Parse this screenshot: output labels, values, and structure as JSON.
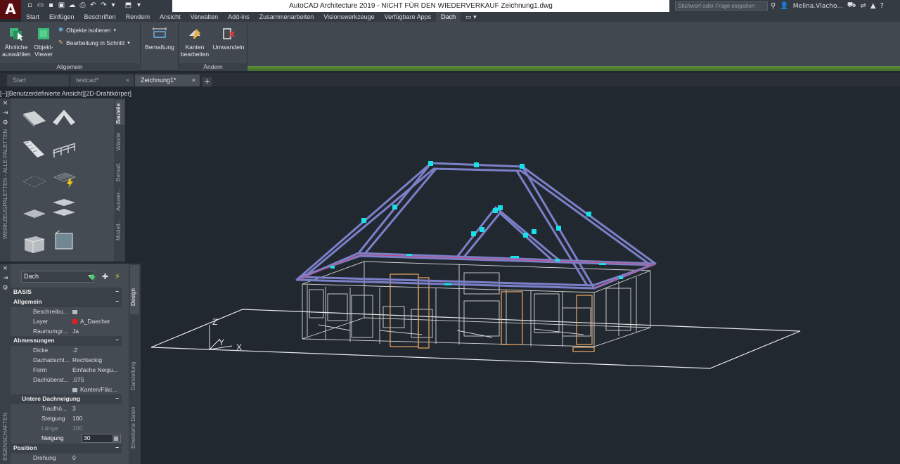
{
  "app": {
    "logo_letter": "A"
  },
  "quick_access": [
    "new-icon",
    "open-icon",
    "save-icon",
    "save-as-icon",
    "cloud-icon",
    "print-icon",
    "undo-icon",
    "redo-icon",
    "share-icon"
  ],
  "title": {
    "text": "AutoCAD Architecture 2019 - NICHT FÜR DEN WIEDERVERKAUF    Zeichnung1.dwg",
    "search_placeholder": "Stichwort oder Frage eingeben",
    "user": "Melina.Vlacho...",
    "help": "?"
  },
  "ribbon_tabs": [
    "Start",
    "Einfügen",
    "Beschriften",
    "Rendern",
    "Ansicht",
    "Verwalten",
    "Add-ins",
    "Zusammenarbeiten",
    "Visionswerkzeuge",
    "Verfügbare Apps",
    "Dach"
  ],
  "ribbon": {
    "active_tab": "Dach",
    "panel_allgemein": {
      "title": "Allgemein",
      "similar_line1": "Ähnliche",
      "similar_line2": "auswählen",
      "viewer_line1": "Objekt-",
      "viewer_line2": "Viewer",
      "isolate": "Objekte isolieren",
      "edit_section": "Bearbeitung in Schnitt"
    },
    "panel_bemassung": {
      "label": "Bemaßung"
    },
    "panel_aendern": {
      "title": "Ändern",
      "edges_line1": "Kanten",
      "edges_line2": "bearbeiten",
      "convert": "Umwandeln"
    }
  },
  "doc_tabs": [
    {
      "label": "Start"
    },
    {
      "label": "testcad*"
    },
    {
      "label": "Zeichnung1*"
    }
  ],
  "viewport": {
    "label": "[−][Benutzerdefinierte Ansicht][2D-Drahtkörper]",
    "ucs_z": "Z",
    "ucs_y": "Y",
    "ucs_x": "X"
  },
  "tool_palette": {
    "title": "WERKZEUGPALETTEN - ALLE PALETTEN",
    "tabs": [
      "Bauteile",
      "Wände",
      "Bemaß",
      "Auswer...",
      "Modell..."
    ],
    "active_tab": "Bauteile"
  },
  "properties": {
    "title": "EIGENSCHAFTEN",
    "object_type": "Dach",
    "tabs": [
      "Design",
      "Darstellung",
      "Erweiterte Daten"
    ],
    "basis": "BASIS",
    "general": {
      "header": "Allgemein",
      "description_label": "Beschreibu...",
      "layer_label": "Layer",
      "layer_value": "A_Daecher",
      "space_label": "Raumumgr...",
      "space_value": "Ja"
    },
    "dimensions": {
      "header": "Abmessungen",
      "thickness_label": "Dicke",
      "thickness_value": ".2",
      "edge_cut_label": "Dachabschl...",
      "edge_cut_value": "Rechteckig",
      "shape_label": "Form",
      "shape_value": "Einfache Neigu...",
      "overhang_label": "Dachüberst...",
      "overhang_value": ".075",
      "edges_value": "Kanten/Fläc..."
    },
    "lower_slope": {
      "header": "Untere Dachneigung",
      "eave_label": "Traufhö...",
      "eave_value": "3",
      "rise_label": "Steigung",
      "rise_value": "100",
      "run_label": "Länge",
      "run_value": "100",
      "slope_label": "Neigung",
      "slope_value": "30"
    },
    "position": {
      "header": "Position",
      "rotation_label": "Drehung",
      "rotation_value": "0"
    }
  },
  "colors": {
    "viewport_bg": "#212830",
    "roof_edges": "#7b80c8",
    "grips": "#18e0e8",
    "walls": "#d8d8d8",
    "doors": "#e0a060",
    "ground_plane": "#e8e8e8"
  }
}
